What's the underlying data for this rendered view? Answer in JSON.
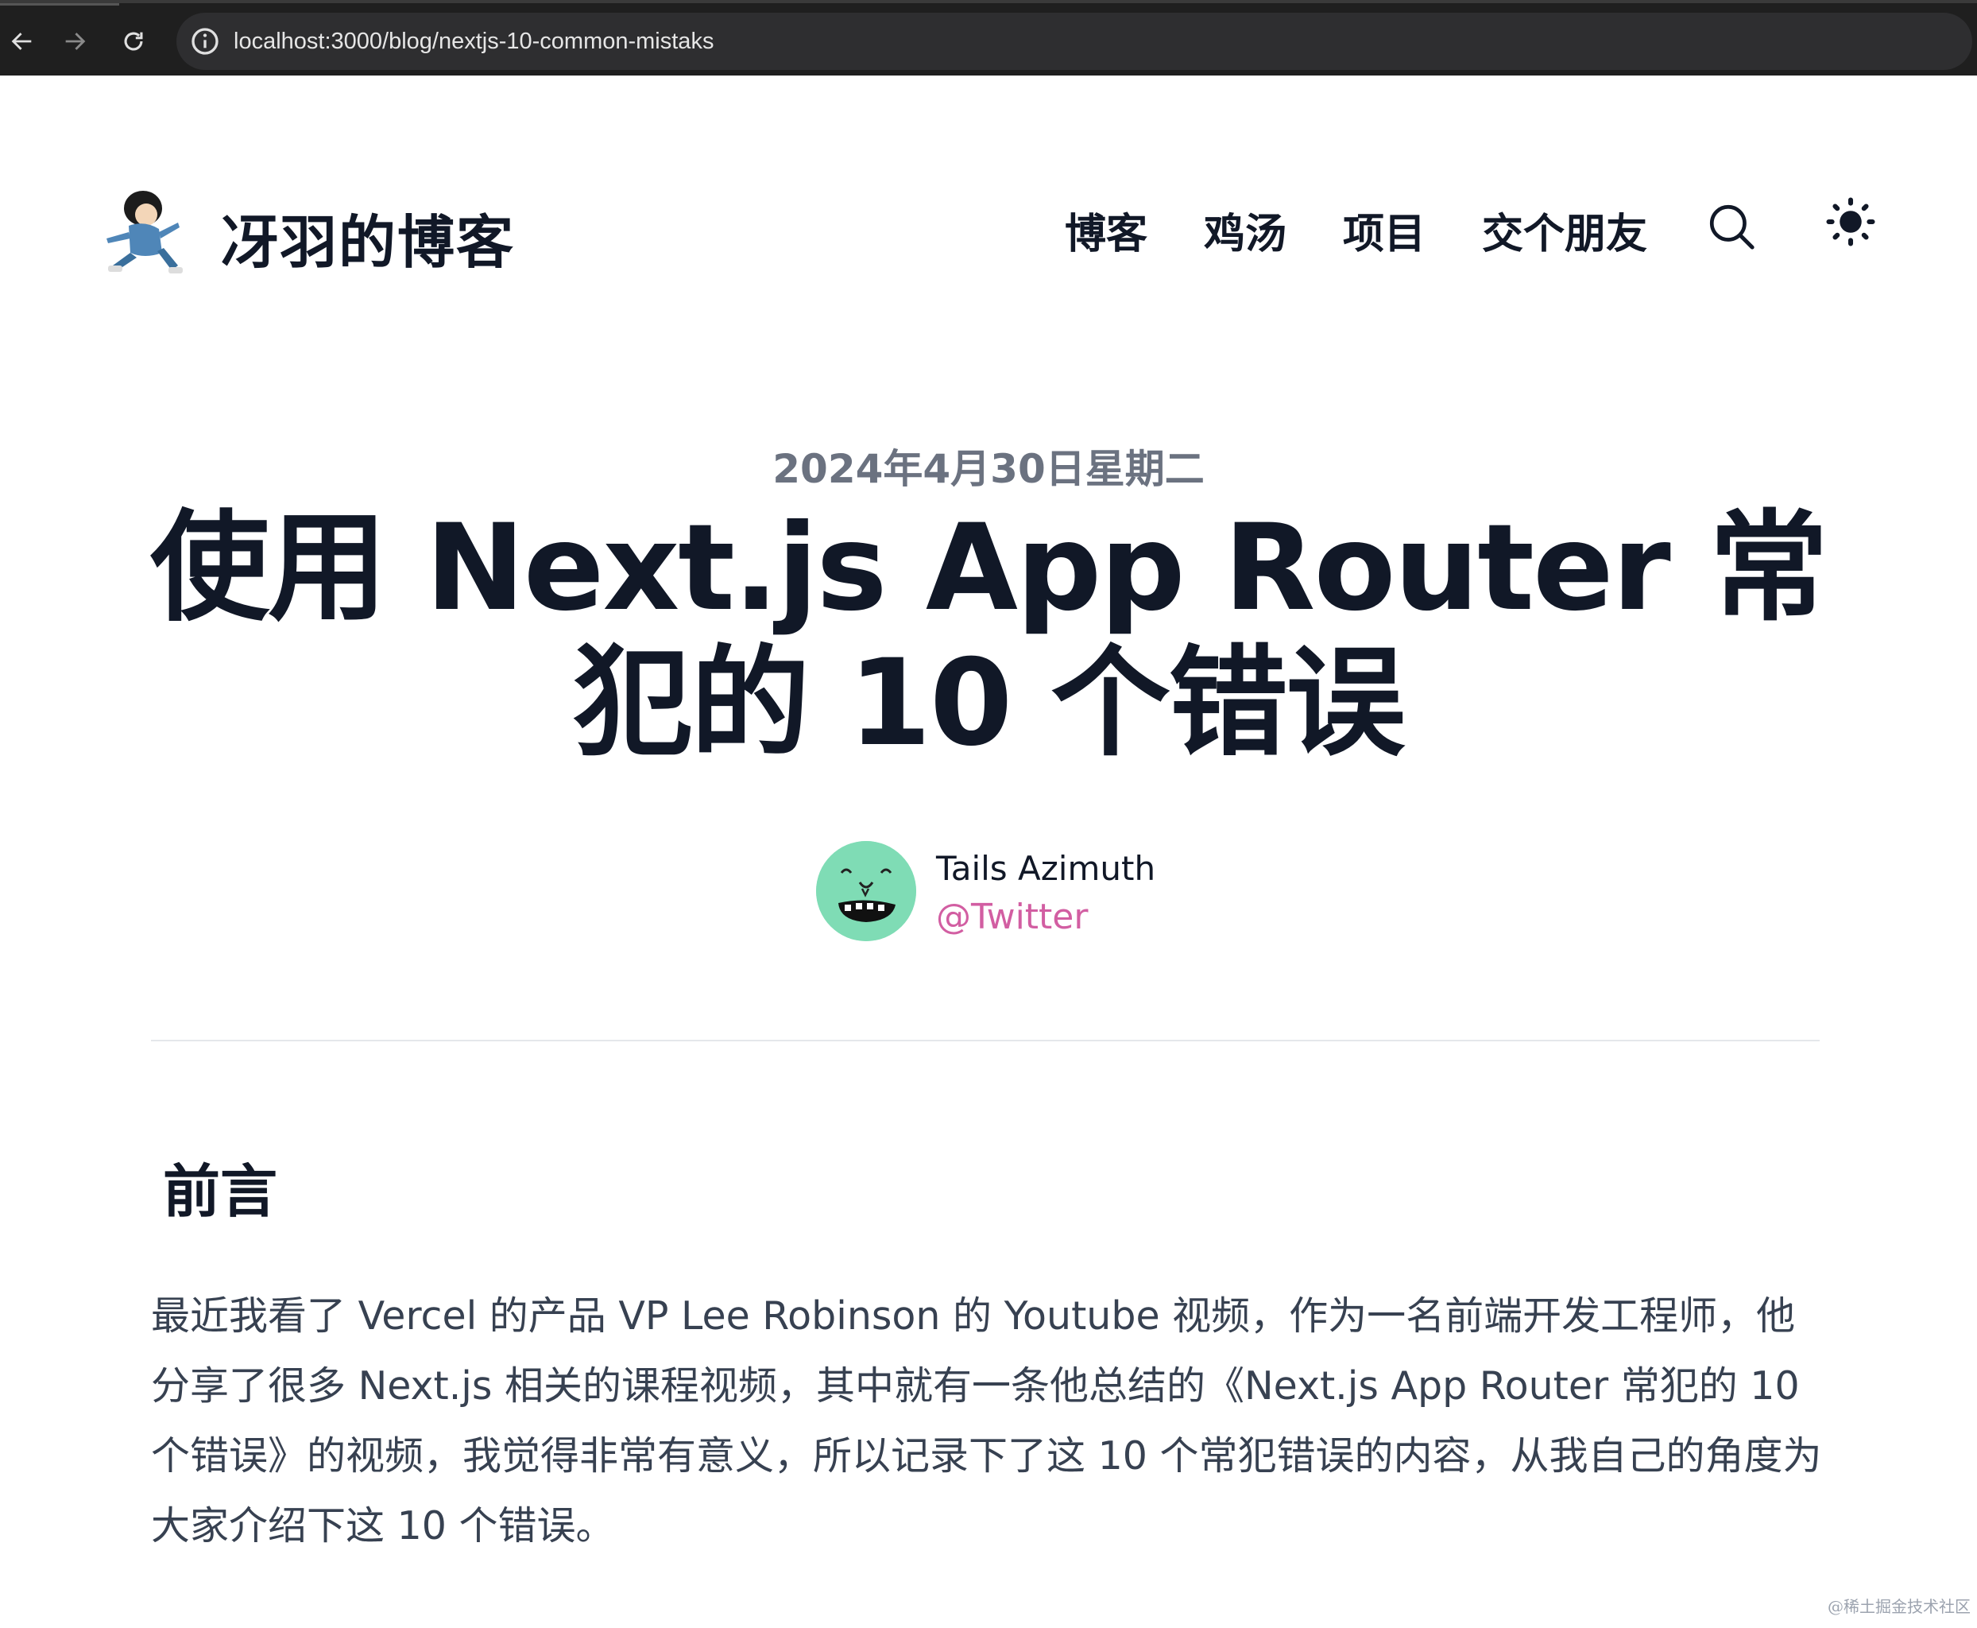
{
  "browser": {
    "url": "localhost:3000/blog/nextjs-10-common-mistaks"
  },
  "header": {
    "site_title": "冴羽的博客",
    "nav": [
      "博客",
      "鸡汤",
      "项目",
      "交个朋友"
    ],
    "icons": [
      "search-icon",
      "sun-icon"
    ]
  },
  "article": {
    "date": "2024年4月30日星期二",
    "title": "使用 Next.js App Router 常犯的 10 个错误",
    "author_name": "Tails Azimuth",
    "author_link": "@Twitter",
    "section_heading": "前言",
    "paragraph": "最近我看了 Vercel 的产品 VP Lee Robinson 的 Youtube 视频，作为一名前端开发工程师，他分享了很多 Next.js 相关的课程视频，其中就有一条他总结的《Next.js App Router 常犯的 10 个错误》的视频，我觉得非常有意义，所以记录下了这 10 个常犯错误的内容，从我自己的角度为大家介绍下这 10 个错误。"
  },
  "watermark": "@稀土掘金技术社区",
  "colors": {
    "text": "#111827",
    "muted": "#6b7280",
    "link": "#d25ea2",
    "avatar_bg": "#7fdcb5"
  }
}
